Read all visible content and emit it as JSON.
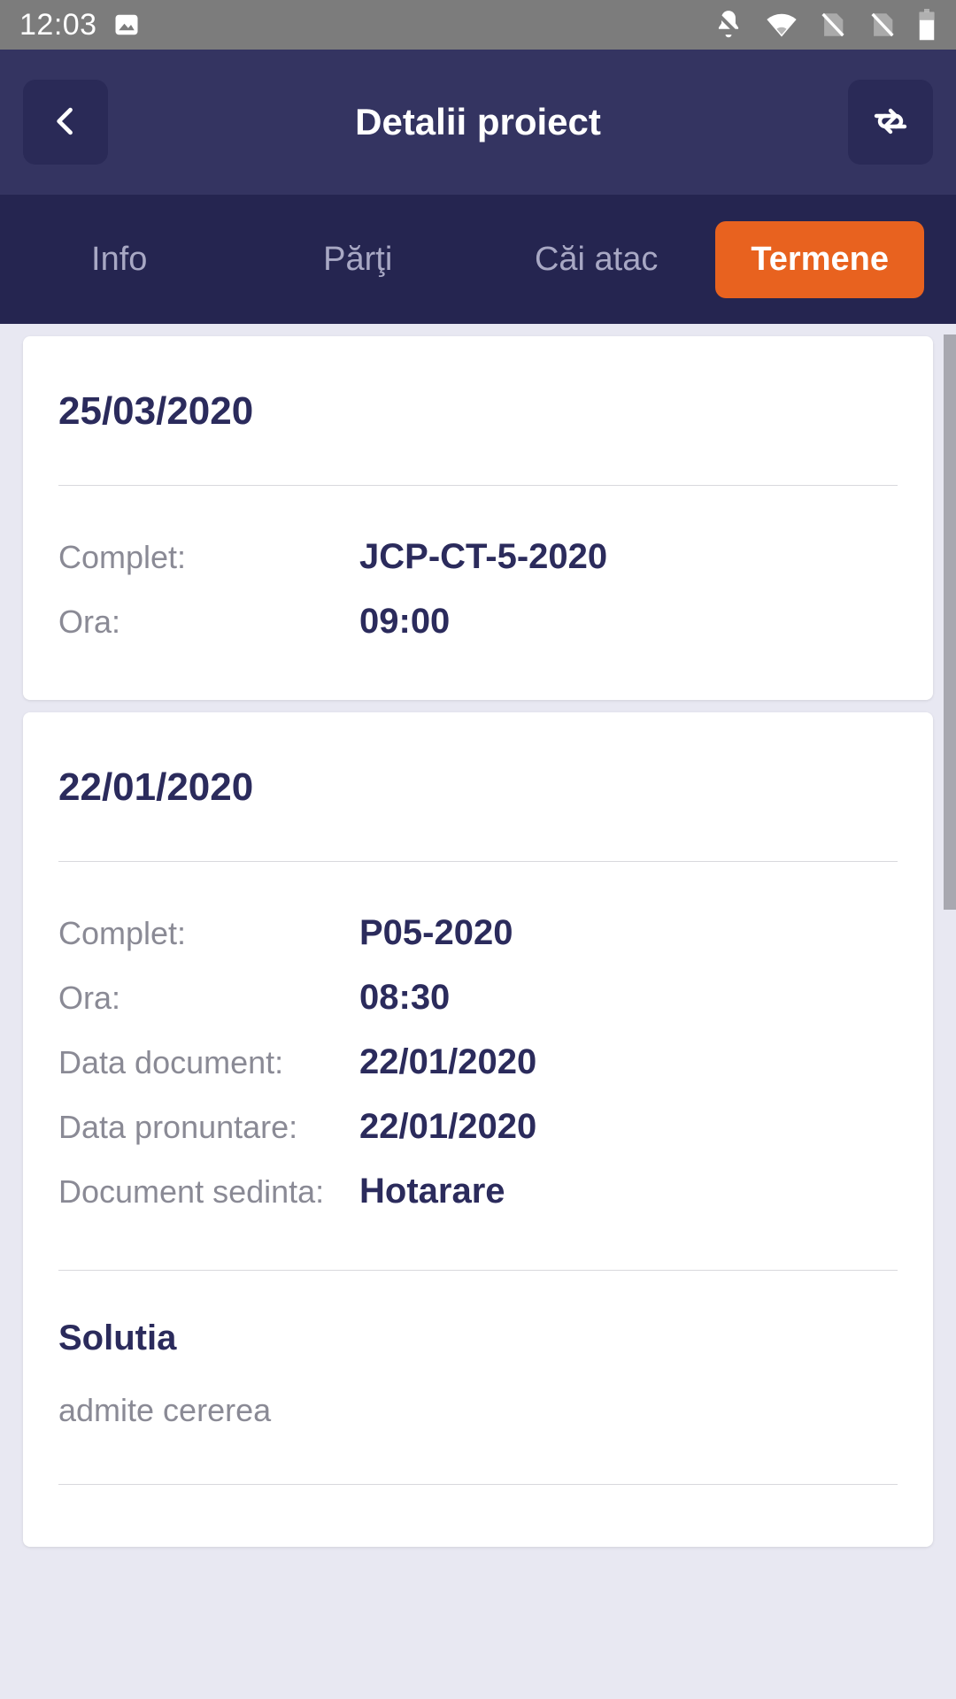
{
  "status_bar": {
    "time": "12:03",
    "left_icons": [
      "image-icon"
    ],
    "right_icons": [
      "notifications-off-icon",
      "wifi-icon",
      "sim-card-off-icon",
      "sim-card-off-icon",
      "battery-icon"
    ],
    "background_color": "#7c7c7c"
  },
  "header": {
    "title": "Detalii proiect",
    "back_icon": "chevron-left-icon",
    "refresh_icon": "sync-icon",
    "background_color": "#343461"
  },
  "tabs": {
    "background_color": "#252550",
    "active_color": "#e8621f",
    "items": [
      {
        "label": "Info",
        "active": false
      },
      {
        "label": "Părţi",
        "active": false
      },
      {
        "label": "Căi atac",
        "active": false
      },
      {
        "label": "Termene",
        "active": true
      }
    ]
  },
  "content": {
    "background_color": "#e8e8f2",
    "cards": [
      {
        "date": "25/03/2020",
        "rows": [
          {
            "label": "Complet:",
            "value": "JCP-CT-5-2020"
          },
          {
            "label": "Ora:",
            "value": "09:00"
          }
        ]
      },
      {
        "date": "22/01/2020",
        "rows": [
          {
            "label": "Complet:",
            "value": "P05-2020"
          },
          {
            "label": "Ora:",
            "value": "08:30"
          },
          {
            "label": "Data document:",
            "value": "22/01/2020"
          },
          {
            "label": "Data pronuntare:",
            "value": "22/01/2020"
          },
          {
            "label": "Document sedinta:",
            "value": "Hotarare"
          }
        ],
        "section": {
          "title": "Solutia",
          "text": "admite cererea"
        }
      }
    ]
  }
}
